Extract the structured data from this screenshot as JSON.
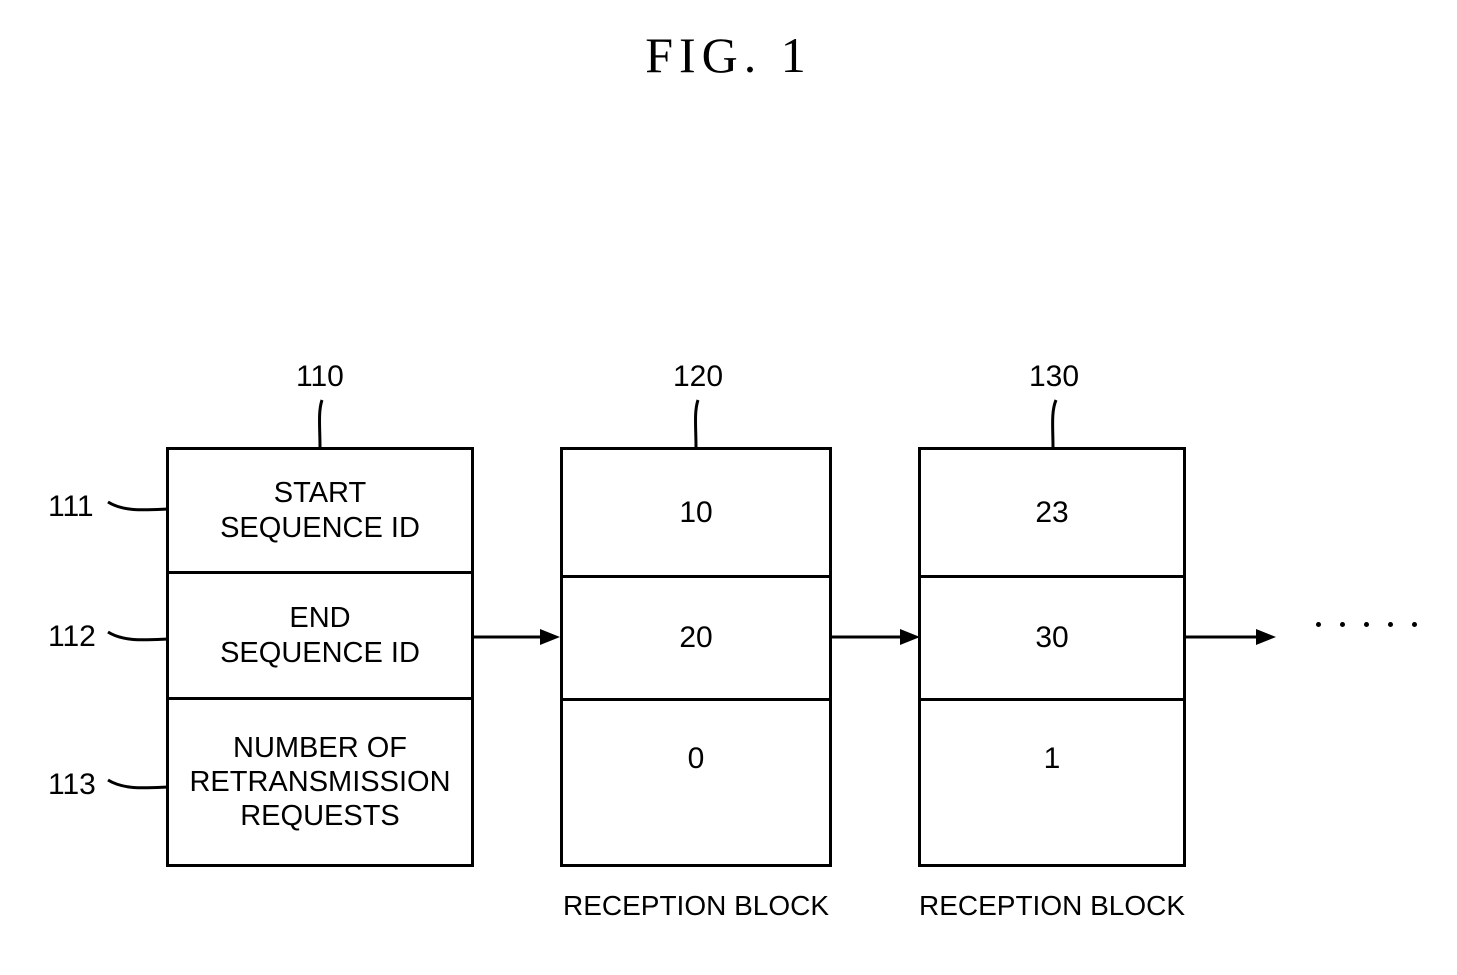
{
  "figure": {
    "title": "FIG.  1"
  },
  "blocks": [
    {
      "ref": "110",
      "kind": "field-name-block",
      "caption": "",
      "cells": [
        {
          "ref": "111",
          "lines": [
            "START",
            "SEQUENCE ID"
          ]
        },
        {
          "ref": "112",
          "lines": [
            "END",
            "SEQUENCE ID"
          ]
        },
        {
          "ref": "113",
          "lines": [
            "NUMBER OF",
            "RETRANSMISSION",
            "REQUESTS"
          ]
        }
      ]
    },
    {
      "ref": "120",
      "kind": "value-block",
      "caption": "RECEPTION BLOCK",
      "cells": [
        {
          "value": "10"
        },
        {
          "value": "20"
        },
        {
          "value": "0"
        }
      ]
    },
    {
      "ref": "130",
      "kind": "value-block",
      "caption": "RECEPTION BLOCK",
      "cells": [
        {
          "value": "23"
        },
        {
          "value": "30"
        },
        {
          "value": "1"
        }
      ]
    }
  ],
  "left_refs": [
    {
      "label": "111"
    },
    {
      "label": "112"
    },
    {
      "label": "113"
    }
  ],
  "top_refs": [
    {
      "label": "110"
    },
    {
      "label": "120"
    },
    {
      "label": "130"
    }
  ],
  "continuation": {
    "dots": 5,
    "arrow": "arrow-right"
  },
  "colors": {
    "ink": "#000000",
    "paper": "#ffffff"
  }
}
